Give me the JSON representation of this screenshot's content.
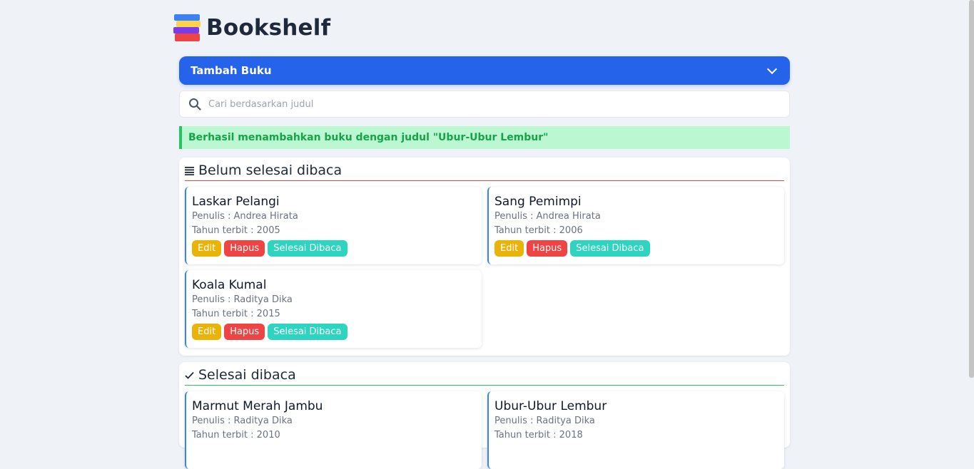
{
  "app": {
    "title": "Bookshelf"
  },
  "add_form": {
    "label": "Tambah Buku"
  },
  "search": {
    "placeholder": "Cari berdasarkan judul"
  },
  "alert": {
    "message": "Berhasil menambahkan buku dengan judul \"Ubur-Ubur Lembur\""
  },
  "unread": {
    "heading": "Belum selesai dibaca",
    "books": [
      {
        "title": "Laskar Pelangi",
        "author": "Penulis : Andrea Hirata",
        "year": "Tahun terbit : 2005"
      },
      {
        "title": "Sang Pemimpi",
        "author": "Penulis : Andrea Hirata",
        "year": "Tahun terbit : 2006"
      },
      {
        "title": "Koala Kumal",
        "author": "Penulis : Raditya Dika",
        "year": "Tahun terbit : 2015"
      }
    ]
  },
  "read": {
    "heading": "Selesai dibaca",
    "books": [
      {
        "title": "Marmut Merah Jambu",
        "author": "Penulis : Raditya Dika",
        "year": "Tahun terbit : 2010"
      },
      {
        "title": "Ubur-Ubur Lembur",
        "author": "Penulis : Raditya Dika",
        "year": "Tahun terbit : 2018"
      }
    ]
  },
  "buttons": {
    "edit": "Edit",
    "delete": "Hapus",
    "finish": "Selesai Dibaca"
  },
  "colors": {
    "accent": "#2563eb",
    "edit": "#eab308",
    "delete": "#ef4444",
    "finish": "#2dd4bf",
    "success_bg": "#bbf7d0",
    "success_text": "#16a34a"
  },
  "icons": {
    "logo": "books-stack-icon",
    "expand": "chevron-down-icon",
    "search": "search-icon",
    "list": "list-icon",
    "check": "check-icon"
  }
}
